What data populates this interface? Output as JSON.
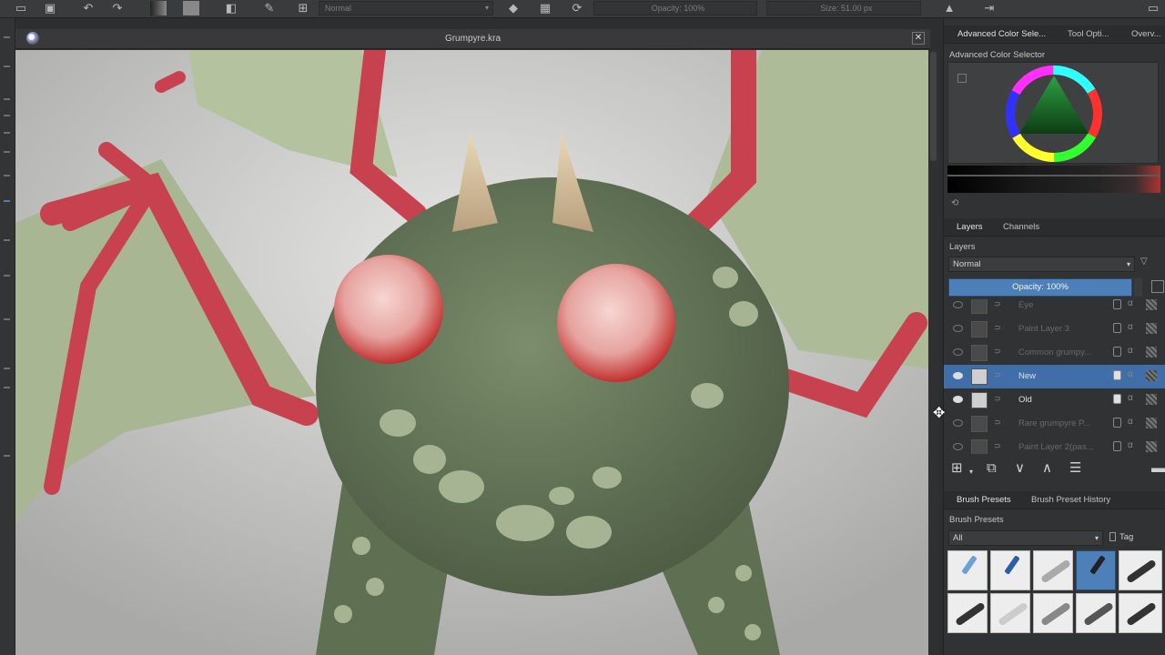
{
  "toolbar": {
    "blend_mode": "Normal",
    "opacity": "Opacity: 100%",
    "size": "Size: 51.00 px"
  },
  "document": {
    "title": "Grumpyre.kra",
    "close_glyph": "✕"
  },
  "docker": {
    "top_tabs": [
      "Advanced Color Sele...",
      "Tool Opti...",
      "Overv..."
    ],
    "color_selector_title": "Advanced Color Selector",
    "layer_tabs": [
      "Layers",
      "Channels"
    ],
    "layers_title": "Layers",
    "blend_mode": "Normal",
    "opacity_label": "Opacity:  100%",
    "layers": [
      {
        "name": "Eye",
        "visible": false,
        "active": false
      },
      {
        "name": "Paint Layer 3",
        "visible": false,
        "active": false
      },
      {
        "name": "Common grumpy...",
        "visible": false,
        "active": false
      },
      {
        "name": "New",
        "visible": true,
        "active": true
      },
      {
        "name": "Old",
        "visible": true,
        "active": false
      },
      {
        "name": "Rare grumpyre P...",
        "visible": false,
        "active": false
      },
      {
        "name": "Paint Layer 2(pas...",
        "visible": false,
        "active": false
      }
    ],
    "preset_tabs": [
      "Brush Presets",
      "Brush Preset History"
    ],
    "presets_title": "Brush Presets",
    "preset_filter": "All",
    "tag_label": "Tag"
  },
  "colors": {
    "accent": "#4d7fb8",
    "panel": "#313234",
    "canvas_bg": "#c9c9c7"
  },
  "icons": {
    "new_layer": "plus-square-icon",
    "duplicate": "duplicate-icon",
    "move_down": "chevron-down-icon",
    "move_up": "chevron-up-icon",
    "properties": "sliders-icon",
    "delete": "trash-icon"
  }
}
